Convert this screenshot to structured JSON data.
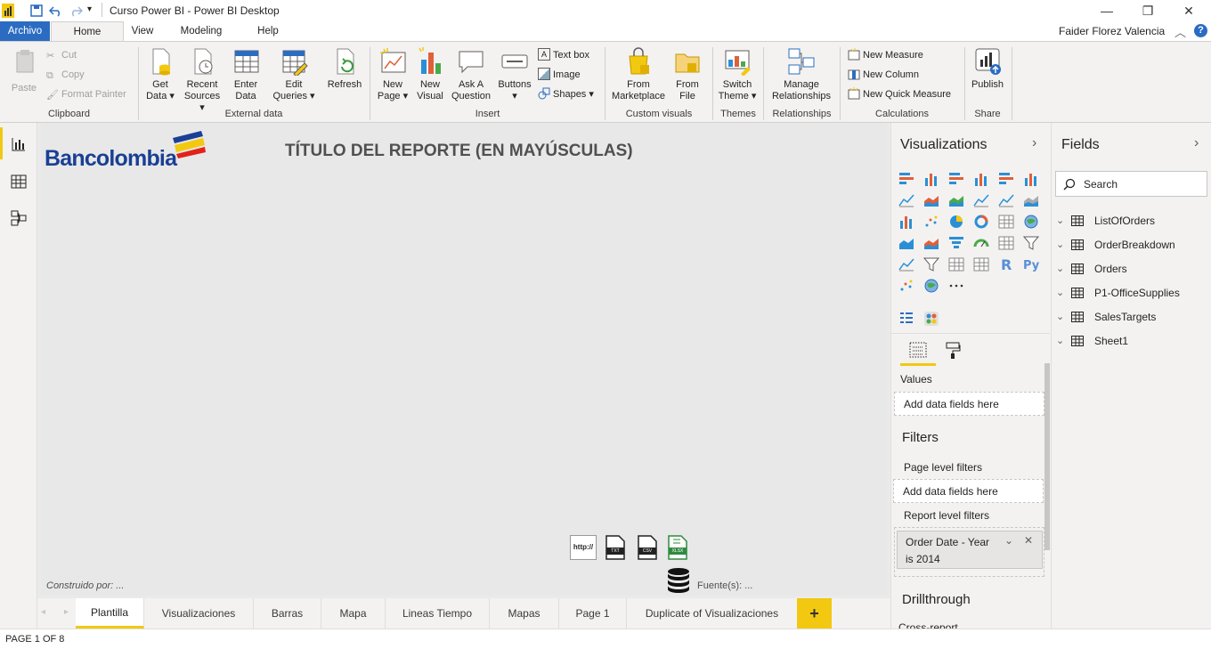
{
  "window": {
    "title": "Curso Power BI - Power BI Desktop",
    "user": "Faider Florez Valencia",
    "help": "?"
  },
  "menu": {
    "archivo": "Archivo",
    "home": "Home",
    "view": "View",
    "modeling": "Modeling",
    "help": "Help"
  },
  "ribbon": {
    "clipboard": {
      "paste": "Paste",
      "cut": "Cut",
      "copy": "Copy",
      "format_painter": "Format Painter",
      "label": "Clipboard"
    },
    "external": {
      "get_data": [
        "Get",
        "Data ▾"
      ],
      "recent": [
        "Recent",
        "Sources ▾"
      ],
      "enter": [
        "Enter",
        "Data"
      ],
      "edit": [
        "Edit",
        "Queries ▾"
      ],
      "refresh": "Refresh",
      "label": "External data"
    },
    "insert": {
      "new_page": [
        "New",
        "Page ▾"
      ],
      "new_visual": [
        "New",
        "Visual"
      ],
      "ask": [
        "Ask A",
        "Question"
      ],
      "buttons": [
        "Buttons",
        "▾"
      ],
      "text_box": "Text box",
      "image": "Image",
      "shapes": "Shapes ▾",
      "label": "Insert"
    },
    "custom": {
      "marketplace": [
        "From",
        "Marketplace"
      ],
      "file": [
        "From",
        "File"
      ],
      "label": "Custom visuals"
    },
    "themes": {
      "switch": [
        "Switch",
        "Theme ▾"
      ],
      "label": "Themes"
    },
    "relationships": {
      "manage": [
        "Manage",
        "Relationships"
      ],
      "label": "Relationships"
    },
    "calculations": {
      "new_measure": "New Measure",
      "new_column": "New Column",
      "new_quick": "New Quick Measure",
      "label": "Calculations"
    },
    "share": {
      "publish": "Publish",
      "label": "Share"
    }
  },
  "canvas": {
    "logo_text": "Bancolombia",
    "report_title": "TÍTULO DEL REPORTE (EN MAYÚSCULAS)",
    "built_by": "Construido por: ...",
    "source": "Fuente(s): ...",
    "file_icons": [
      "http://",
      "TXT",
      "CSV",
      "XLSX"
    ]
  },
  "tabs": [
    "Plantilla",
    "Visualizaciones",
    "Barras",
    "Mapa",
    "Lineas Tiempo",
    "Mapas",
    "Page 1",
    "Duplicate of Visualizaciones"
  ],
  "add_tab": "+",
  "status": "PAGE 1 OF 8",
  "visualizations": {
    "title": "Visualizations",
    "values_label": "Values",
    "values_drop": "Add data fields here",
    "filters_title": "Filters",
    "page_filters": "Page level filters",
    "page_drop": "Add data fields here",
    "report_filters": "Report level filters",
    "filter_card": [
      "Order Date - Year",
      "is 2014"
    ],
    "drillthrough": "Drillthrough",
    "cross_report": "Cross-report"
  },
  "fields": {
    "title": "Fields",
    "search_placeholder": "Search",
    "tables": [
      "ListOfOrders",
      "OrderBreakdown",
      "Orders",
      "P1-OfficeSupplies",
      "SalesTargets",
      "Sheet1"
    ]
  },
  "colors": {
    "accent_blue": "#2b6cc2",
    "brand_yellow": "#f2c811",
    "bancolombia_blue": "#1a3f94",
    "bancolombia_red": "#e2231a"
  }
}
